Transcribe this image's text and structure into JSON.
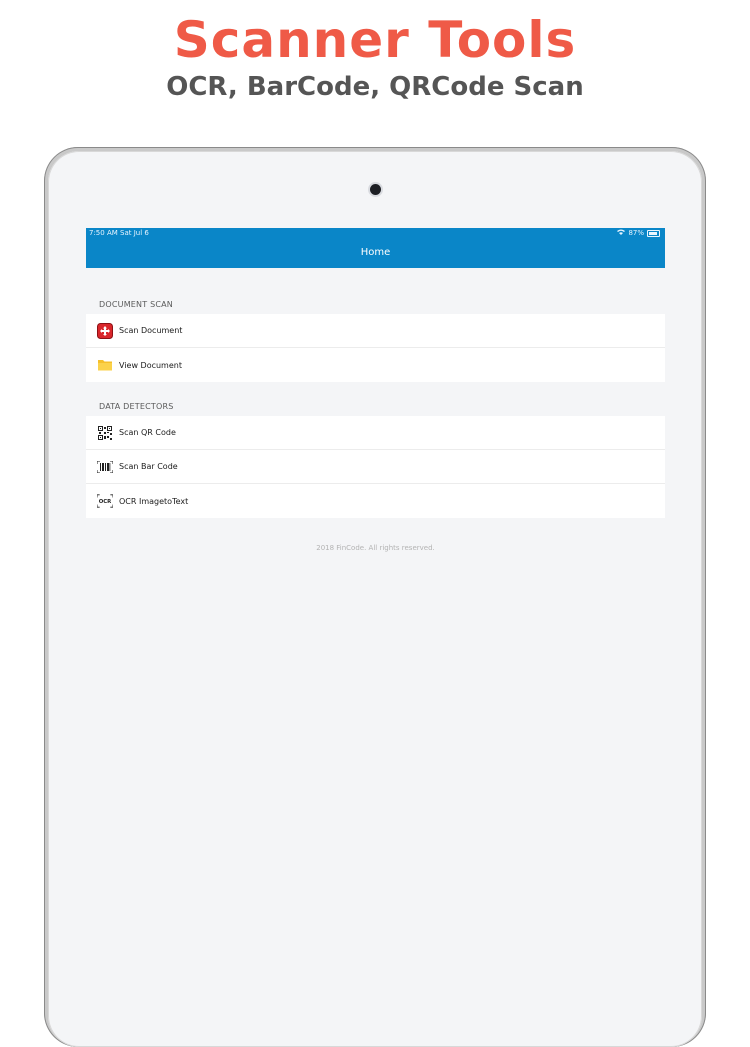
{
  "promo": {
    "title": "Scanner Tools",
    "subtitle": "OCR, BarCode, QRCode Scan",
    "colors": {
      "title": "#ef5a47",
      "subtitle": "#555555"
    }
  },
  "status_bar": {
    "time_date": "7:50 AM   Sat Jul 6",
    "battery": "87%"
  },
  "nav": {
    "title": "Home",
    "color": "#0a86c8"
  },
  "sections": [
    {
      "header": "DOCUMENT SCAN",
      "items": [
        {
          "label": "Scan Document",
          "icon": "scan-document-icon"
        },
        {
          "label": "View Document",
          "icon": "folder-icon"
        }
      ]
    },
    {
      "header": "DATA DETECTORS",
      "items": [
        {
          "label": "Scan QR Code",
          "icon": "qr-code-icon"
        },
        {
          "label": "Scan Bar Code",
          "icon": "barcode-icon"
        },
        {
          "label": "OCR ImagetoText",
          "icon": "ocr-icon"
        }
      ]
    }
  ],
  "footer": "2018 FinCode. All rights reserved."
}
